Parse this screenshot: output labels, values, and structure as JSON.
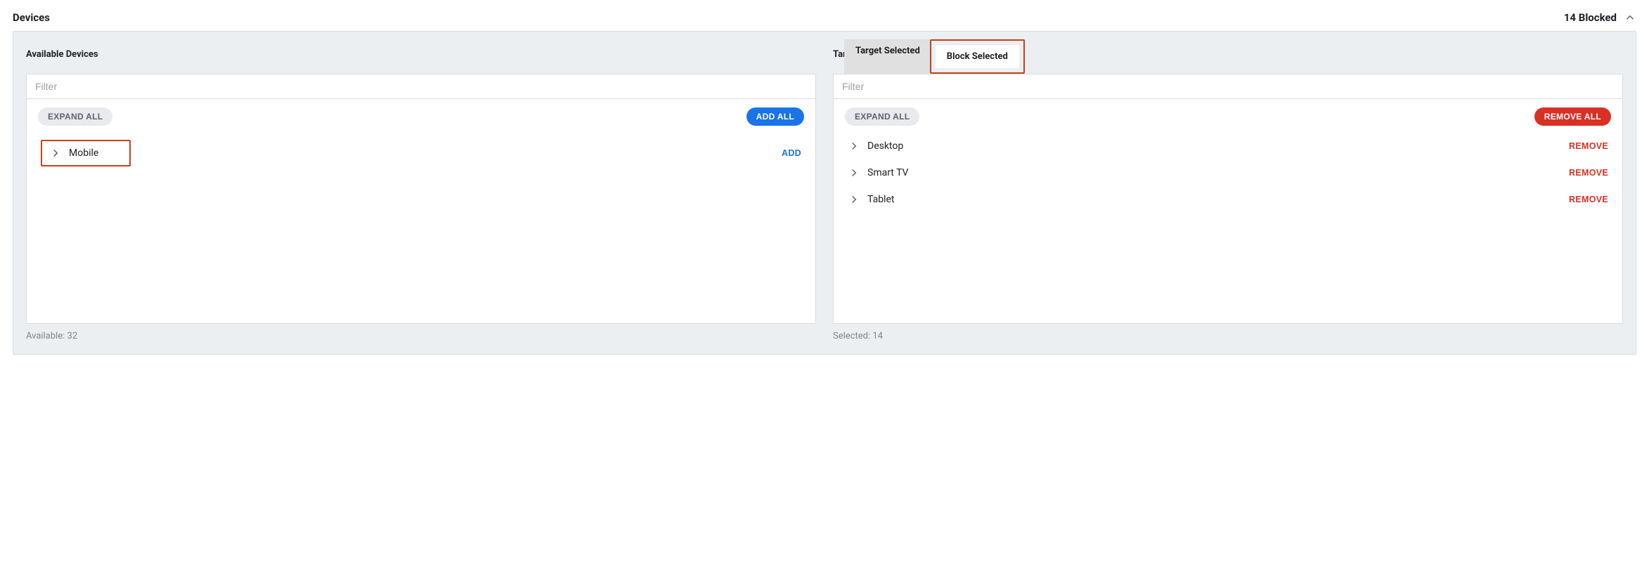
{
  "header": {
    "title": "Devices",
    "blocked_label": "14 Blocked"
  },
  "available": {
    "title": "Available Devices",
    "filter_placeholder": "Filter",
    "expand_all": "EXPAND ALL",
    "add_all": "ADD ALL",
    "items": [
      {
        "label": "Mobile",
        "action": "ADD"
      }
    ],
    "footer": "Available: 32"
  },
  "targeted": {
    "title": "Targeted Devices",
    "tab_target": "Target Selected",
    "tab_block": "Block Selected",
    "filter_placeholder": "Filter",
    "expand_all": "EXPAND ALL",
    "remove_all": "REMOVE ALL",
    "items": [
      {
        "label": "Desktop",
        "action": "REMOVE"
      },
      {
        "label": "Smart TV",
        "action": "REMOVE"
      },
      {
        "label": "Tablet",
        "action": "REMOVE"
      }
    ],
    "footer": "Selected: 14"
  }
}
